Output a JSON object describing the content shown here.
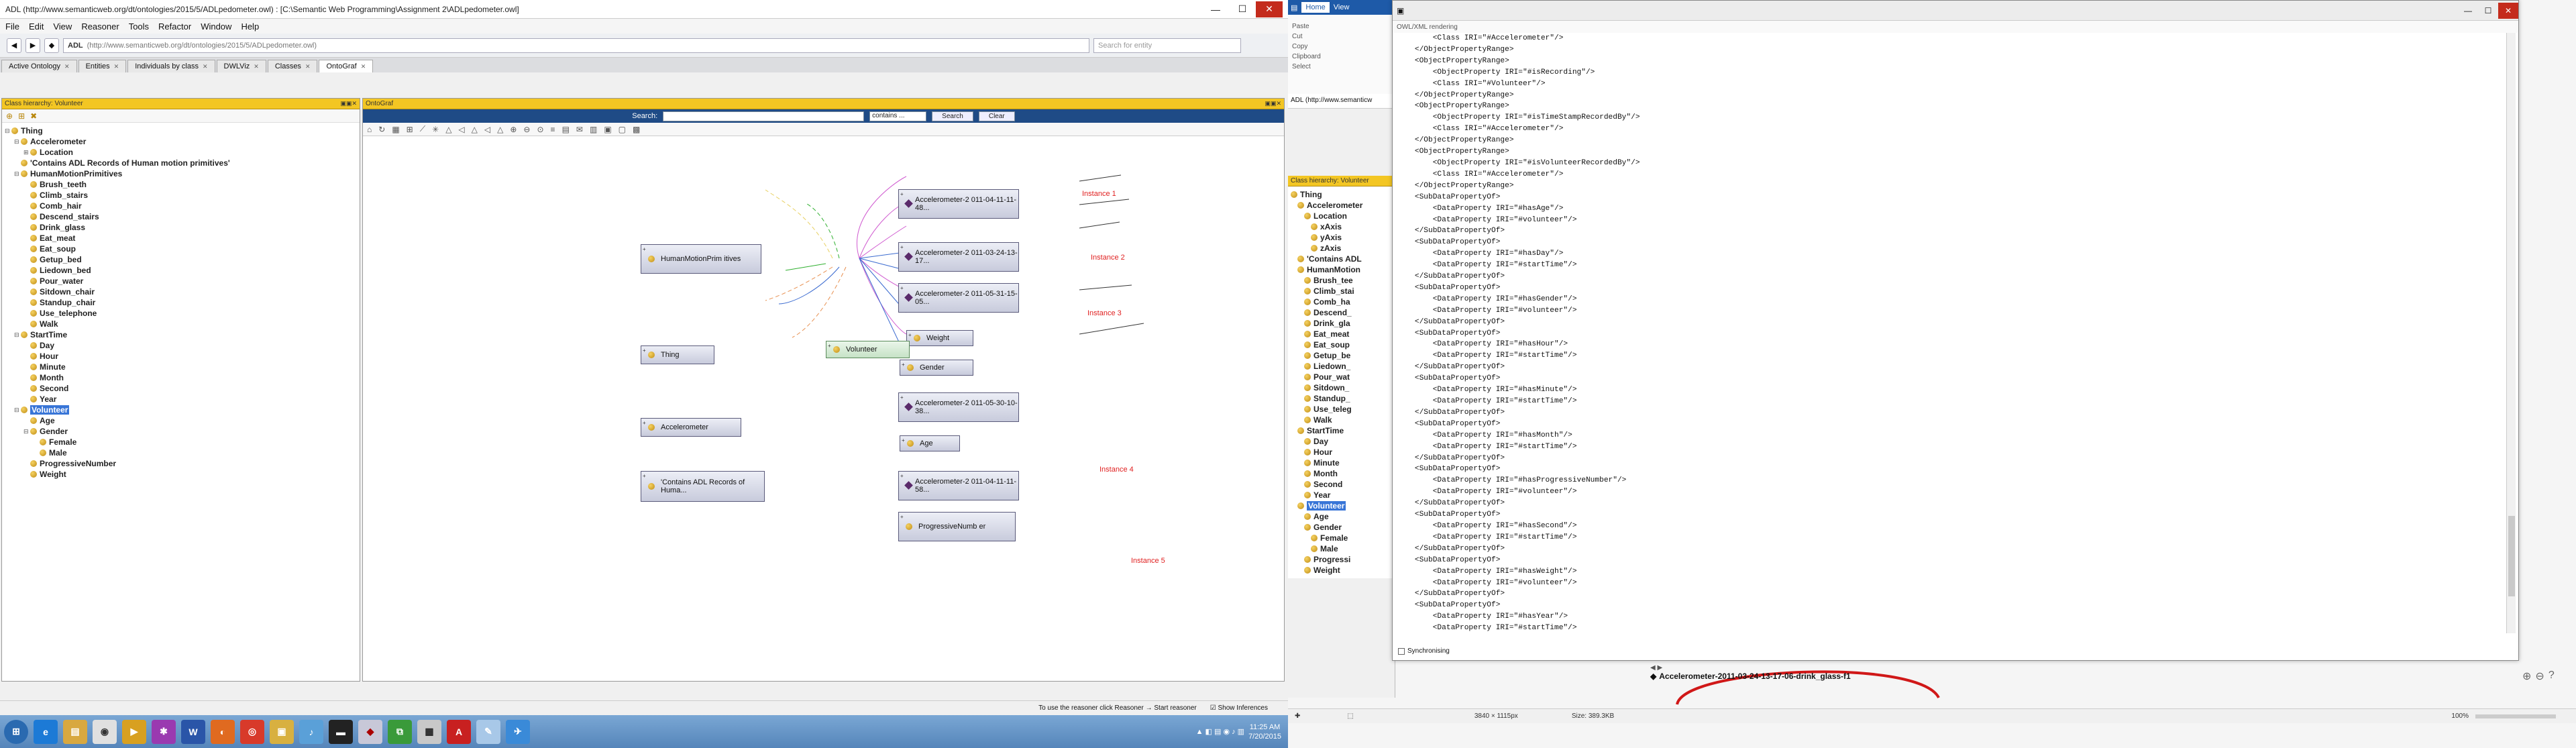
{
  "left_window": {
    "title": "ADL (http://www.semanticweb.org/dt/ontologies/2015/5/ADLpedometer.owl) : [C:\\Semantic Web Programming\\Assignment 2\\ADLpedometer.owl]",
    "menu": [
      "File",
      "Edit",
      "View",
      "Reasoner",
      "Tools",
      "Refactor",
      "Window",
      "Help"
    ],
    "toolbar": {
      "iri_name": "ADL",
      "iri": "(http://www.semanticweb.org/dt/ontologies/2015/5/ADLpedometer.owl)",
      "search_placeholder": "Search for entity"
    },
    "tabs": [
      "Active Ontology",
      "Entities",
      "Individuals by class",
      "DWLViz",
      "Classes",
      "OntoGraf"
    ],
    "class_hierarchy_header": "Class hierarchy: Volunteer",
    "ontograf_header": "OntoGraf",
    "tree": [
      {
        "label": "Thing",
        "level": 0,
        "tog": "⊟"
      },
      {
        "label": "Accelerometer",
        "level": 1,
        "tog": "⊟"
      },
      {
        "label": "Location",
        "level": 2,
        "tog": "⊞"
      },
      {
        "label": "'Contains ADL Records of Human motion primitives'",
        "level": 1,
        "tog": ""
      },
      {
        "label": "HumanMotionPrimitives",
        "level": 1,
        "tog": "⊟"
      },
      {
        "label": "Brush_teeth",
        "level": 2,
        "tog": ""
      },
      {
        "label": "Climb_stairs",
        "level": 2,
        "tog": ""
      },
      {
        "label": "Comb_hair",
        "level": 2,
        "tog": ""
      },
      {
        "label": "Descend_stairs",
        "level": 2,
        "tog": ""
      },
      {
        "label": "Drink_glass",
        "level": 2,
        "tog": ""
      },
      {
        "label": "Eat_meat",
        "level": 2,
        "tog": ""
      },
      {
        "label": "Eat_soup",
        "level": 2,
        "tog": ""
      },
      {
        "label": "Getup_bed",
        "level": 2,
        "tog": ""
      },
      {
        "label": "Liedown_bed",
        "level": 2,
        "tog": ""
      },
      {
        "label": "Pour_water",
        "level": 2,
        "tog": ""
      },
      {
        "label": "Sitdown_chair",
        "level": 2,
        "tog": ""
      },
      {
        "label": "Standup_chair",
        "level": 2,
        "tog": ""
      },
      {
        "label": "Use_telephone",
        "level": 2,
        "tog": ""
      },
      {
        "label": "Walk",
        "level": 2,
        "tog": ""
      },
      {
        "label": "StartTime",
        "level": 1,
        "tog": "⊟"
      },
      {
        "label": "Day",
        "level": 2,
        "tog": ""
      },
      {
        "label": "Hour",
        "level": 2,
        "tog": ""
      },
      {
        "label": "Minute",
        "level": 2,
        "tog": ""
      },
      {
        "label": "Month",
        "level": 2,
        "tog": ""
      },
      {
        "label": "Second",
        "level": 2,
        "tog": ""
      },
      {
        "label": "Year",
        "level": 2,
        "tog": ""
      },
      {
        "label": "Volunteer",
        "level": 1,
        "tog": "⊟",
        "selected": true
      },
      {
        "label": "Age",
        "level": 2,
        "tog": ""
      },
      {
        "label": "Gender",
        "level": 2,
        "tog": "⊟"
      },
      {
        "label": "Female",
        "level": 3,
        "tog": ""
      },
      {
        "label": "Male",
        "level": 3,
        "tog": ""
      },
      {
        "label": "ProgressiveNumber",
        "level": 2,
        "tog": ""
      },
      {
        "label": "Weight",
        "level": 2,
        "tog": ""
      }
    ],
    "ontograf_search": {
      "label": "Search:",
      "mode": "contains ...",
      "search_btn": "Search",
      "clear_btn": "Clear"
    },
    "graph_nodes": [
      {
        "id": "acc1",
        "label": "Accelerometer-2 011-04-11-11-48...",
        "instance": true
      },
      {
        "id": "acc2",
        "label": "Accelerometer-2 011-03-24-13-17...",
        "instance": true
      },
      {
        "id": "acc3",
        "label": "Accelerometer-2 011-05-31-15-05...",
        "instance": true
      },
      {
        "id": "weight",
        "label": "Weight",
        "instance": false
      },
      {
        "id": "gender",
        "label": "Gender",
        "instance": false
      },
      {
        "id": "acc4",
        "label": "Accelerometer-2 011-05-30-10-38...",
        "instance": true
      },
      {
        "id": "age",
        "label": "Age",
        "instance": false
      },
      {
        "id": "acc5",
        "label": "Accelerometer-2 011-04-11-11-58...",
        "instance": true
      },
      {
        "id": "prognum",
        "label": "ProgressiveNumb er",
        "instance": false
      },
      {
        "id": "hmp",
        "label": "HumanMotionPrim itives",
        "instance": false
      },
      {
        "id": "thing",
        "label": "Thing",
        "instance": false
      },
      {
        "id": "volunteer",
        "label": "Volunteer",
        "instance": false
      },
      {
        "id": "accel",
        "label": "Accelerometer",
        "instance": false
      },
      {
        "id": "contains",
        "label": "'Contains ADL Records of Huma...",
        "instance": false
      }
    ],
    "instance_labels": [
      "Instance 1",
      "Instance 2",
      "Instance 3",
      "Instance 4",
      "Instance 5"
    ],
    "status": {
      "reasoner_hint": "To use the reasoner click Reasoner → Start reasoner",
      "show_inferences": "Show Inferences"
    }
  },
  "taskbar": {
    "time": "11:25 AM",
    "date": "7/20/2015"
  },
  "right": {
    "ribbon": {
      "tabs": [
        "Home",
        "View"
      ],
      "items": [
        "Paste",
        "Cut",
        "Copy",
        "Clipboard",
        "Select"
      ]
    },
    "small_tree": [
      "Thing",
      "Accelerometer",
      "Location",
      "xAxis",
      "yAxis",
      "zAxis",
      "'Contains ADL",
      "HumanMotion",
      "Brush_tee",
      "Climb_stai",
      "Comb_ha",
      "Descend_",
      "Drink_gla",
      "Eat_meat",
      "Eat_soup",
      "Getup_be",
      "Liedown_",
      "Pour_wat",
      "Sitdown_",
      "Standup_",
      "Use_teleg",
      "Walk",
      "StartTime",
      "Day",
      "Hour",
      "Minute",
      "Month",
      "Second",
      "Year",
      "Volunteer",
      "Age",
      "Gender",
      "Female",
      "Male",
      "Progressi",
      "Weight"
    ],
    "small_url": "ADL (http://www.semanticw",
    "small_header": "Class hierarchy: Volunteer",
    "owl_window_title": "OWL/XML rendering",
    "xml_lines": [
      "        <Class IRI=\"#Accelerometer\"/>",
      "    </ObjectPropertyRange>",
      "    <ObjectPropertyRange>",
      "        <ObjectProperty IRI=\"#isRecording\"/>",
      "        <Class IRI=\"#Volunteer\"/>",
      "    </ObjectPropertyRange>",
      "    <ObjectPropertyRange>",
      "        <ObjectProperty IRI=\"#isTimeStampRecordedBy\"/>",
      "        <Class IRI=\"#Accelerometer\"/>",
      "    </ObjectPropertyRange>",
      "    <ObjectPropertyRange>",
      "        <ObjectProperty IRI=\"#isVolunteerRecordedBy\"/>",
      "        <Class IRI=\"#Accelerometer\"/>",
      "    </ObjectPropertyRange>",
      "    <SubDataPropertyOf>",
      "        <DataProperty IRI=\"#hasAge\"/>",
      "        <DataProperty IRI=\"#volunteer\"/>",
      "    </SubDataPropertyOf>",
      "    <SubDataPropertyOf>",
      "        <DataProperty IRI=\"#hasDay\"/>",
      "        <DataProperty IRI=\"#startTime\"/>",
      "    </SubDataPropertyOf>",
      "    <SubDataPropertyOf>",
      "        <DataProperty IRI=\"#hasGender\"/>",
      "        <DataProperty IRI=\"#volunteer\"/>",
      "    </SubDataPropertyOf>",
      "    <SubDataPropertyOf>",
      "        <DataProperty IRI=\"#hasHour\"/>",
      "        <DataProperty IRI=\"#startTime\"/>",
      "    </SubDataPropertyOf>",
      "    <SubDataPropertyOf>",
      "        <DataProperty IRI=\"#hasMinute\"/>",
      "        <DataProperty IRI=\"#startTime\"/>",
      "    </SubDataPropertyOf>",
      "    <SubDataPropertyOf>",
      "        <DataProperty IRI=\"#hasMonth\"/>",
      "        <DataProperty IRI=\"#startTime\"/>",
      "    </SubDataPropertyOf>",
      "    <SubDataPropertyOf>",
      "        <DataProperty IRI=\"#hasProgressiveNumber\"/>",
      "        <DataProperty IRI=\"#volunteer\"/>",
      "    </SubDataPropertyOf>",
      "    <SubDataPropertyOf>",
      "        <DataProperty IRI=\"#hasSecond\"/>",
      "        <DataProperty IRI=\"#startTime\"/>",
      "    </SubDataPropertyOf>",
      "    <SubDataPropertyOf>",
      "        <DataProperty IRI=\"#hasWeight\"/>",
      "        <DataProperty IRI=\"#volunteer\"/>",
      "    </SubDataPropertyOf>",
      "    <SubDataPropertyOf>",
      "        <DataProperty IRI=\"#hasYear\"/>",
      "        <DataProperty IRI=\"#startTime\"/>"
    ],
    "sync_label": "Synchronising",
    "bottom_items": [
      "Accelerometer-2011-03-24-13-17-06-drink_glass-f1"
    ],
    "status": {
      "dims": "3840 × 1115px",
      "size": "Size: 389.3KB",
      "zoom": "100%"
    }
  }
}
